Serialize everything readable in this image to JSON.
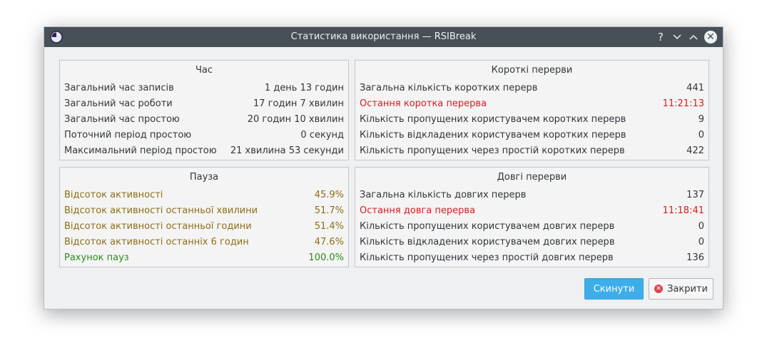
{
  "window": {
    "title": "Статистика використання — RSIBreak"
  },
  "time_panel": {
    "title": "Час",
    "rows": [
      {
        "label": "Загальний час записів",
        "value": "1 день 13 годин"
      },
      {
        "label": "Загальний час роботи",
        "value": "17 годин 7 хвилин"
      },
      {
        "label": "Загальний час простою",
        "value": "20 годин 10 хвилин"
      },
      {
        "label": "Поточний період простою",
        "value": "0 секунд"
      },
      {
        "label": "Максимальний період простою",
        "value": "21 хвилина 53 секунди"
      }
    ]
  },
  "short_breaks_panel": {
    "title": "Короткі перерви",
    "rows": [
      {
        "label": "Загальна кількість коротких перерв",
        "value": "441"
      },
      {
        "label": "Остання коротка перерва",
        "value": "11:21:13"
      },
      {
        "label": "Кількість пропущених користувачем коротких перерв",
        "value": "9"
      },
      {
        "label": "Кількість відкладених користувачем коротких перерв",
        "value": "0"
      },
      {
        "label": "Кількість пропущених через простій коротких перерв",
        "value": "422"
      }
    ]
  },
  "pause_panel": {
    "title": "Пауза",
    "rows": [
      {
        "label": "Відсоток активності",
        "value": "45.9%"
      },
      {
        "label": "Відсоток активності останньої хвилини",
        "value": "51.7%"
      },
      {
        "label": "Відсоток активності останньої години",
        "value": "51.4%"
      },
      {
        "label": "Відсоток активності останніх 6 годин",
        "value": "47.6%"
      },
      {
        "label": "Рахунок пауз",
        "value": "100.0%"
      }
    ]
  },
  "long_breaks_panel": {
    "title": "Довгі перерви",
    "rows": [
      {
        "label": "Загальна кількість довгих перерв",
        "value": "137"
      },
      {
        "label": "Остання довга перерва",
        "value": "11:18:41"
      },
      {
        "label": "Кількість пропущених користувачем довгих перерв",
        "value": "0"
      },
      {
        "label": "Кількість відкладених користувачем довгих перерв",
        "value": "0"
      },
      {
        "label": "Кількість пропущених через простій довгих перерв",
        "value": "136"
      }
    ]
  },
  "buttons": {
    "reset": "Скинути",
    "close": "Закрити"
  },
  "colors": {
    "titlebar": "#475057",
    "accent": "#3daee9",
    "highlight_red": "#da1c1c",
    "activity_amber": "#8c6f14",
    "pause_green": "#2b8c1c"
  },
  "icons": {
    "app": "rsibreak-icon",
    "help": "help-icon",
    "minimize": "minimize-icon",
    "maximize": "maximize-icon",
    "close": "close-icon"
  }
}
